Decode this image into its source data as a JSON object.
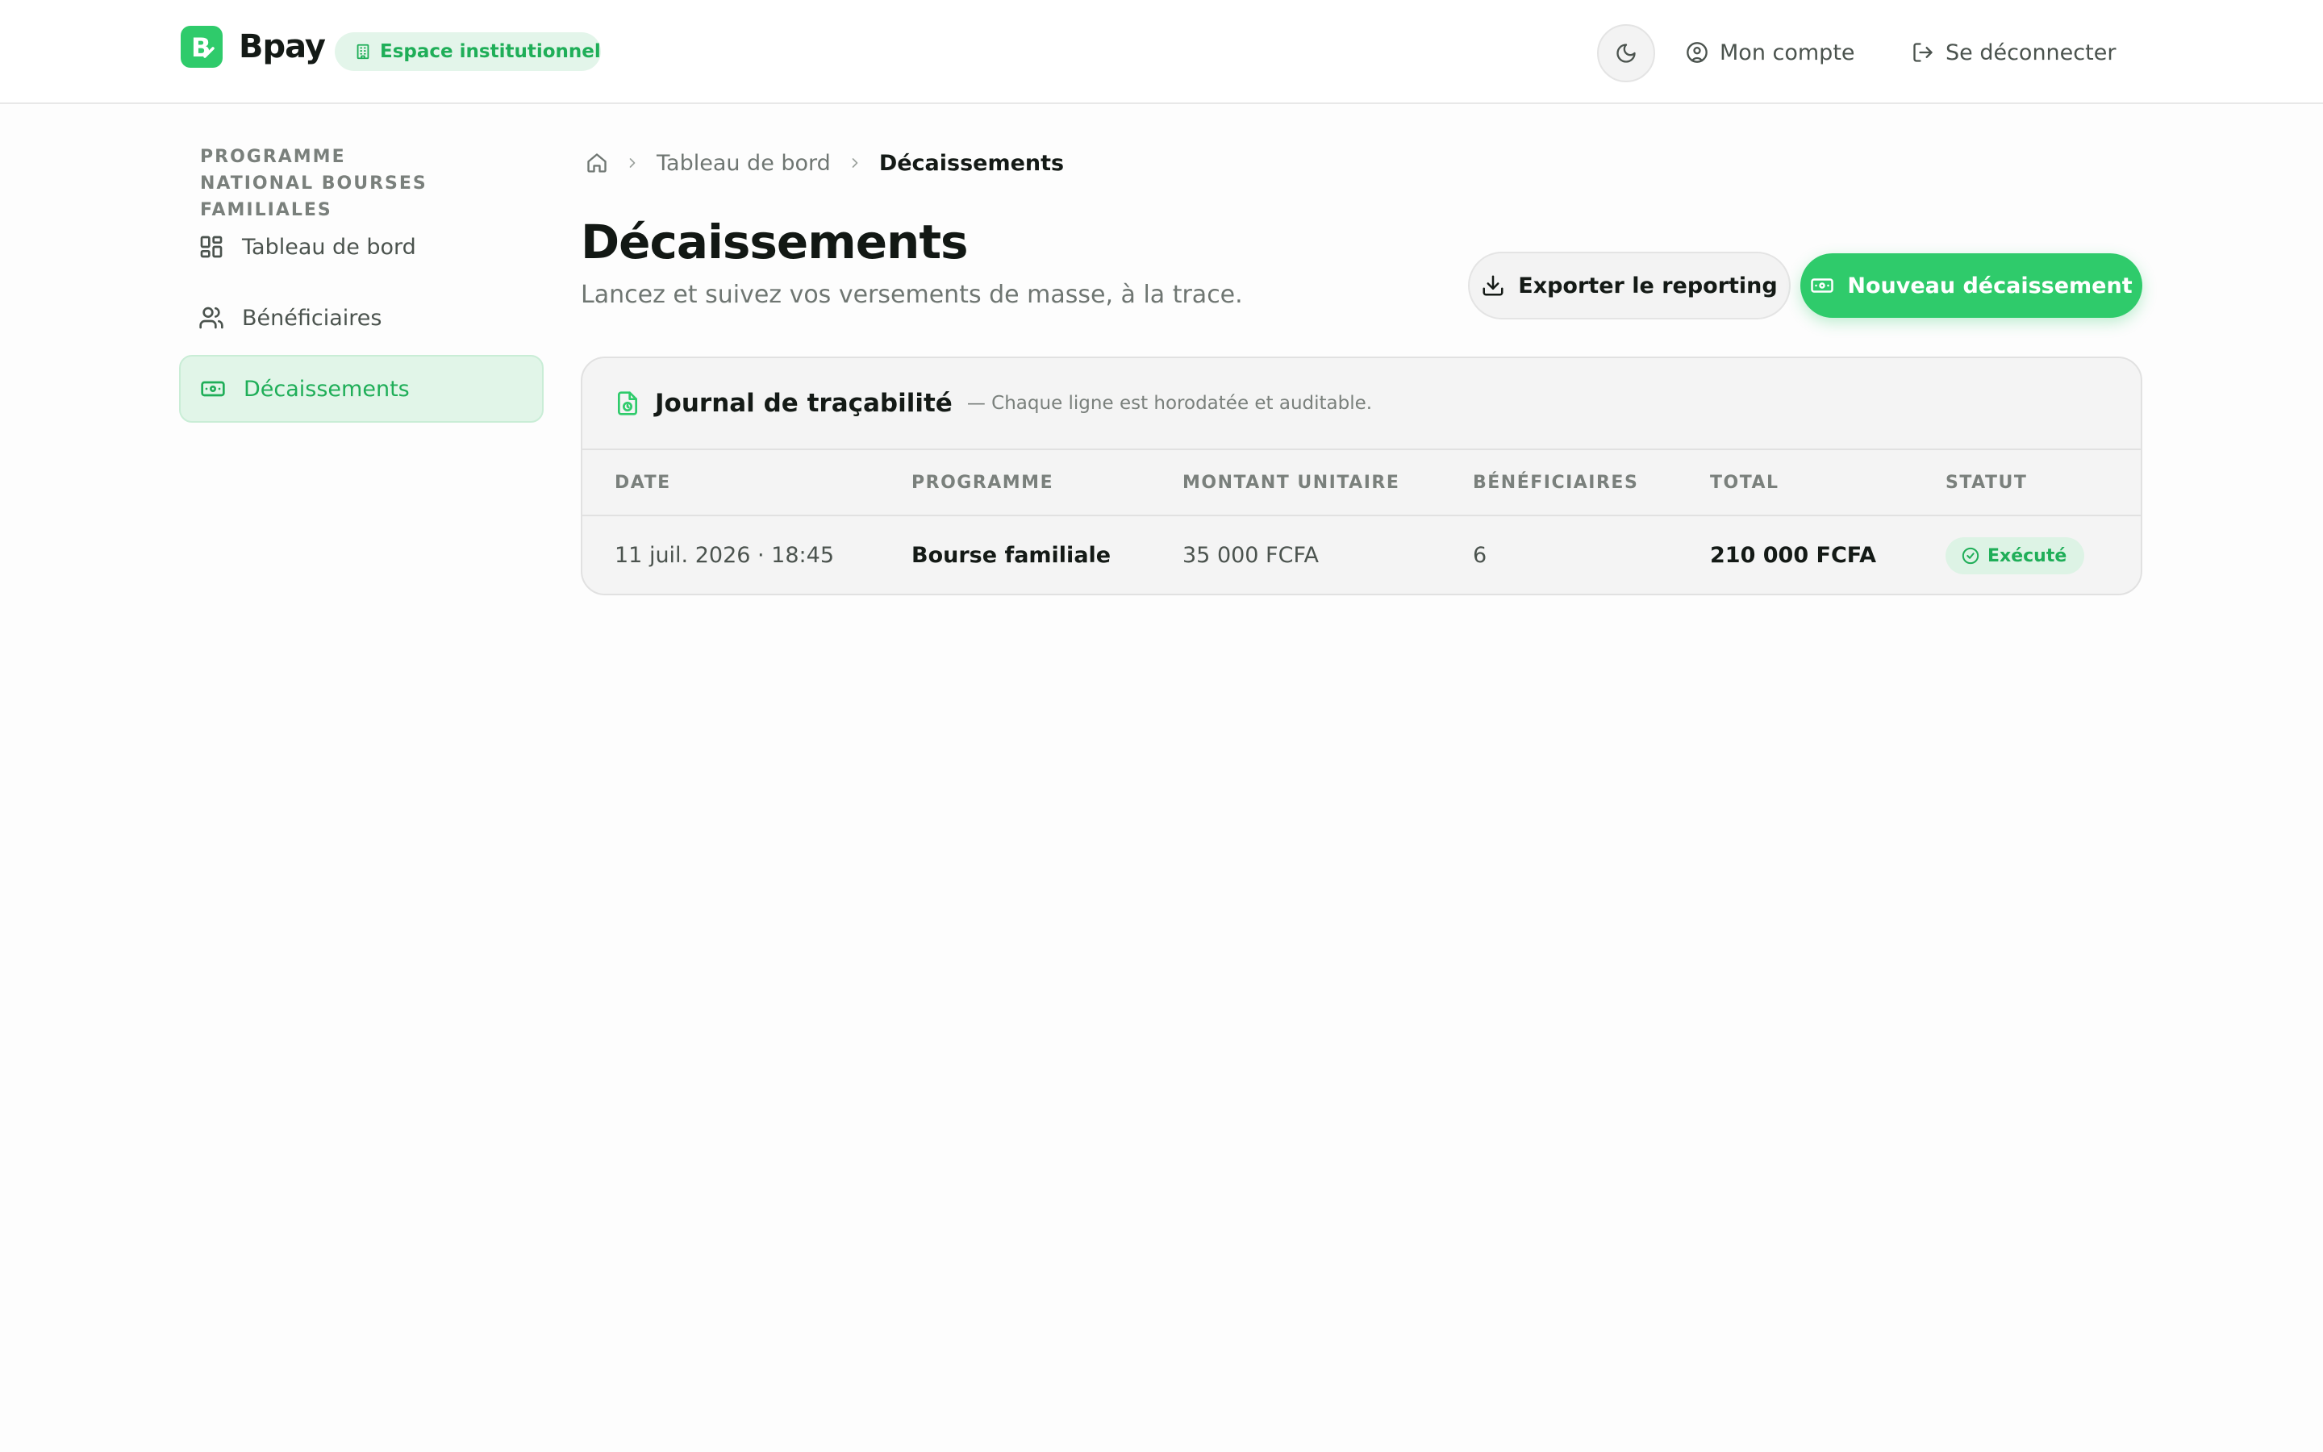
{
  "header": {
    "brand": "Bpay",
    "logo_letter": "B",
    "badge_label": "Espace institutionnel",
    "account_label": "Mon compte",
    "logout_label": "Se déconnecter",
    "icons": [
      "building-icon",
      "moon-icon",
      "user-circle-icon",
      "logout-icon"
    ]
  },
  "sidebar": {
    "title": "PROGRAMME NATIONAL BOURSES FAMILIALES",
    "items": [
      {
        "label": "Tableau de bord",
        "icon": "dashboard-icon",
        "active": false
      },
      {
        "label": "Bénéficiaires",
        "icon": "users-icon",
        "active": false
      },
      {
        "label": "Décaissements",
        "icon": "banknote-icon",
        "active": true
      }
    ]
  },
  "breadcrumb": {
    "items": [
      "Tableau de bord",
      "Décaissements"
    ]
  },
  "page": {
    "title": "Décaissements",
    "subtitle": "Lancez et suivez vos versements de masse, à la trace.",
    "export_label": "Exporter le reporting",
    "new_label": "Nouveau décaissement"
  },
  "journal": {
    "title": "Journal de traçabilité",
    "subtitle": "— Chaque ligne est horodatée et auditable.",
    "columns": [
      "DATE",
      "PROGRAMME",
      "MONTANT UNITAIRE",
      "BÉNÉFICIAIRES",
      "TOTAL",
      "STATUT"
    ],
    "rows": [
      {
        "date": "11 juil. 2026 · 18:45",
        "programme": "Bourse familiale",
        "montant": "35 000 FCFA",
        "beneficiaires": "6",
        "total": "210 000 FCFA",
        "statut": "Exécuté"
      }
    ]
  },
  "colors": {
    "accent": "#2fcb6b",
    "accent_text": "#1fae58",
    "accent_soft": "#e1f5e8",
    "text_primary": "#141a16",
    "text_muted": "#6f7672"
  }
}
